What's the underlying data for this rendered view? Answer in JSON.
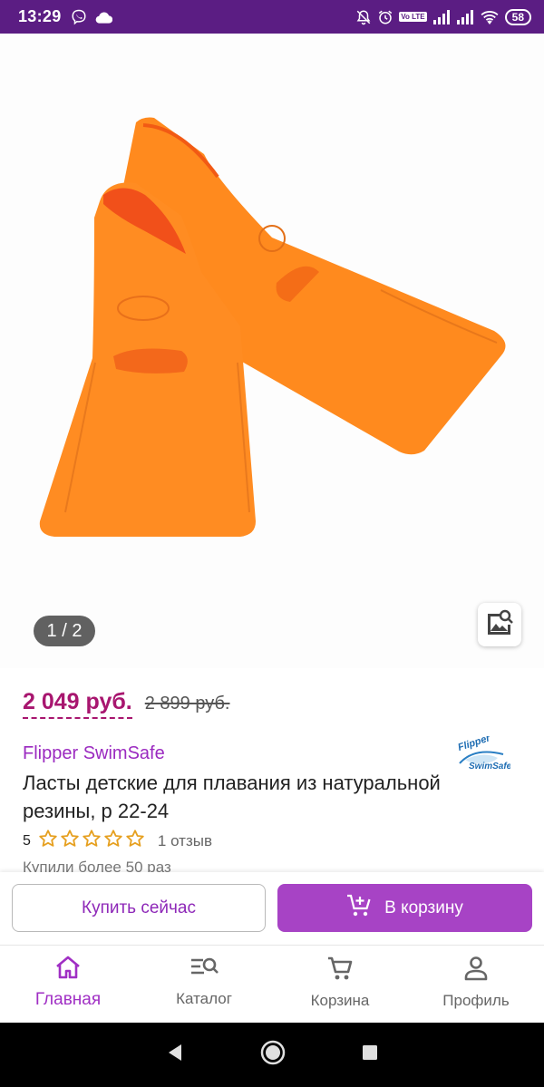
{
  "status_bar": {
    "time": "13:29",
    "battery": "58",
    "volte": "Vo LTE",
    "left_icons": [
      "viber-icon",
      "cloud-icon"
    ],
    "right_icons": [
      "mute-icon",
      "alarm-icon",
      "volte-icon",
      "signal-icon",
      "signal-icon",
      "wifi-icon",
      "battery-icon"
    ]
  },
  "gallery": {
    "counter": "1 / 2",
    "zoom_icon": "image-search-icon"
  },
  "product": {
    "price_current": "2 049 руб.",
    "price_old": "2 899 руб.",
    "brand": "Flipper SwimSafe",
    "brand_logo_text_1": "Flipper",
    "brand_logo_text_2": "SwimSafe",
    "title": "Ласты детские для плавания из натуральной резины, р 22-24",
    "rating_value": "5",
    "rating_stars": 5,
    "reviews": "1 отзыв",
    "bought": "Купили более 50 раз"
  },
  "actions": {
    "buy_now": "Купить сейчас",
    "to_cart": "В корзину"
  },
  "bottom_nav": {
    "items": [
      {
        "label": "Главная",
        "icon": "home-icon",
        "active": true
      },
      {
        "label": "Каталог",
        "icon": "catalog-search-icon",
        "active": false
      },
      {
        "label": "Корзина",
        "icon": "cart-icon",
        "active": false
      },
      {
        "label": "Профиль",
        "icon": "profile-icon",
        "active": false
      }
    ]
  },
  "colors": {
    "status_bar": "#5b1d83",
    "price": "#a8166f",
    "brand": "#9b2ac0",
    "cart_button": "#a743c5",
    "fin_orange": "#ff8a1e"
  }
}
